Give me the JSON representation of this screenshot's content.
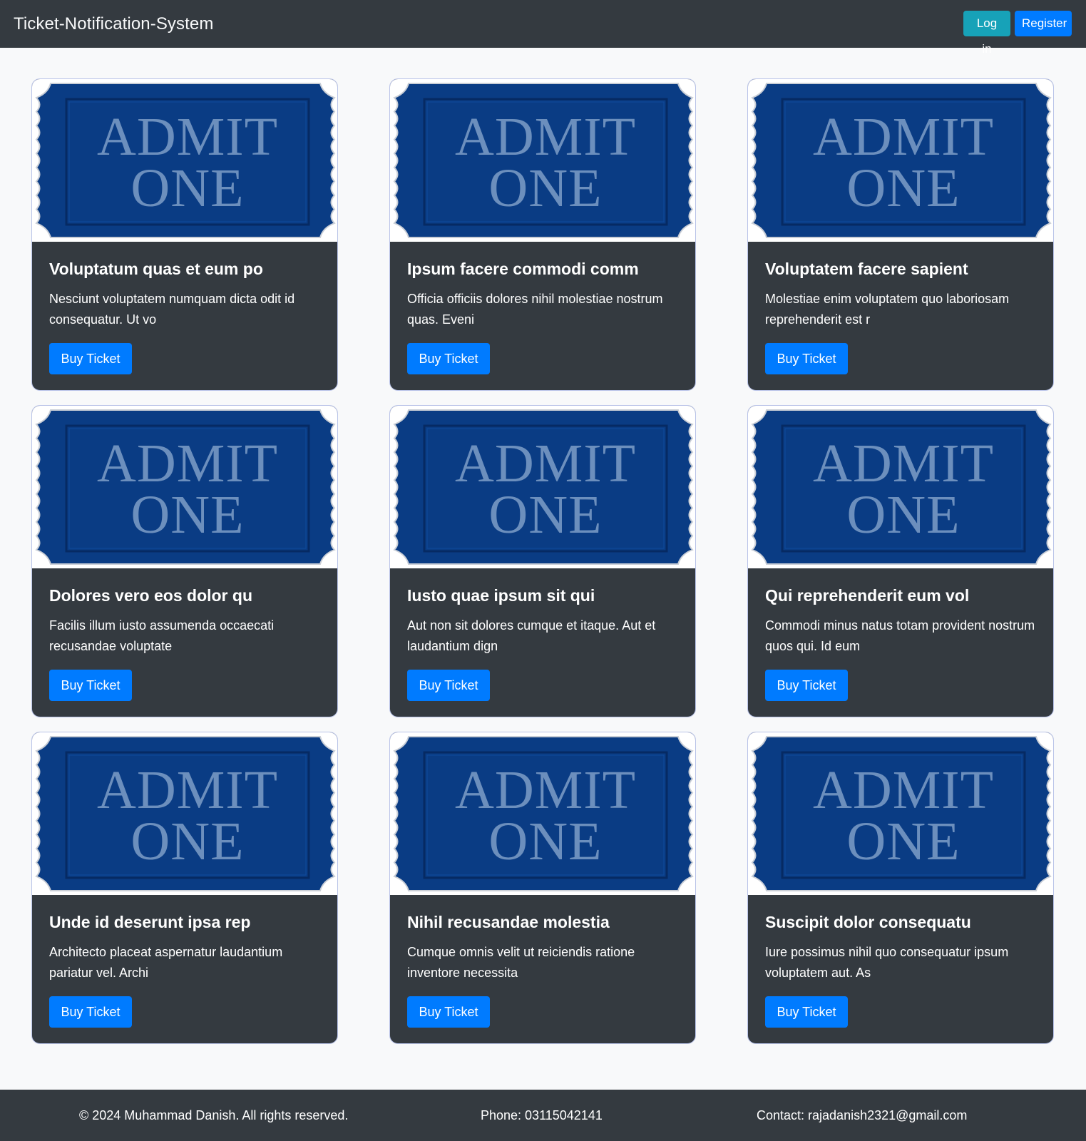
{
  "navbar": {
    "brand": "Ticket-Notification-System",
    "login_label": "Log in",
    "register_label": "Register"
  },
  "ticket_image": {
    "line1": "ADMIT",
    "line2": "ONE",
    "colors": {
      "ticket_blue": "#0a3c84",
      "text_blue": "#6c8fbd"
    }
  },
  "cards": [
    {
      "title": "Voluptatum quas et eum po",
      "text": "Nesciunt voluptatem numquam dicta odit id consequatur. Ut vo",
      "button": "Buy Ticket"
    },
    {
      "title": "Ipsum facere commodi comm",
      "text": "Officia officiis dolores nihil molestiae nostrum quas. Eveni",
      "button": "Buy Ticket"
    },
    {
      "title": "Voluptatem facere sapient",
      "text": "Molestiae enim voluptatem quo laboriosam reprehenderit est r",
      "button": "Buy Ticket"
    },
    {
      "title": "Dolores vero eos dolor qu",
      "text": "Facilis illum iusto assumenda occaecati recusandae voluptate",
      "button": "Buy Ticket"
    },
    {
      "title": "Iusto quae ipsum sit qui",
      "text": "Aut non sit dolores cumque et itaque. Aut et laudantium dign",
      "button": "Buy Ticket"
    },
    {
      "title": "Qui reprehenderit eum vol",
      "text": "Commodi minus natus totam provident nostrum quos qui. Id eum",
      "button": "Buy Ticket"
    },
    {
      "title": "Unde id deserunt ipsa rep",
      "text": "Architecto placeat aspernatur laudantium pariatur vel. Archi",
      "button": "Buy Ticket"
    },
    {
      "title": "Nihil recusandae molestia",
      "text": "Cumque omnis velit ut reiciendis ratione inventore necessita",
      "button": "Buy Ticket"
    },
    {
      "title": "Suscipit dolor consequatu",
      "text": "Iure possimus nihil quo consequatur ipsum voluptatem aut. As",
      "button": "Buy Ticket"
    }
  ],
  "footer": {
    "copyright": "© 2024 Muhammad Danish. All rights reserved.",
    "phone": "Phone: 03115042141",
    "contact": "Contact: rajadanish2321@gmail.com"
  }
}
